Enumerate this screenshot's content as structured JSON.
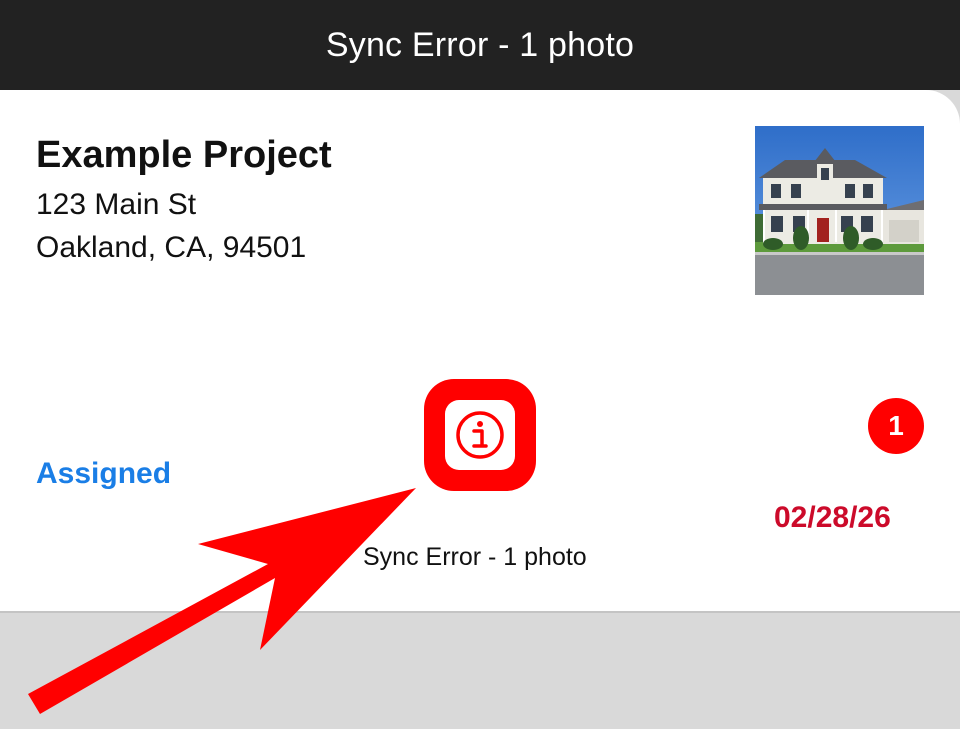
{
  "header": {
    "title": "Sync Error - 1 photo"
  },
  "project": {
    "name": "Example Project",
    "address_line1": "123 Main St",
    "address_line2": "Oakland, CA, 94501",
    "status": "Assigned",
    "due_date": "02/28/26",
    "photo_count_badge": "1"
  },
  "sync": {
    "icon": "info-icon",
    "caption": "Sync Error - 1 photo"
  },
  "colors": {
    "header_bg": "#222222",
    "accent_red": "#ff0000",
    "status_blue": "#1a7ee6",
    "date_red": "#cc0a2a",
    "page_bg": "#d9d9d9"
  }
}
